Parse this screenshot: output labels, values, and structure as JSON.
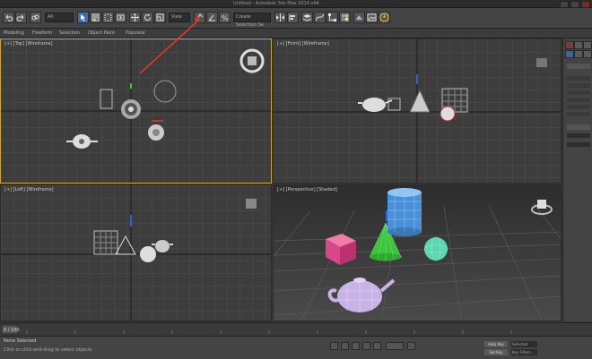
{
  "window": {
    "title": "Untitled - Autodesk 3ds Max 2014 x64",
    "buttons": [
      "minimize",
      "maximize",
      "close"
    ]
  },
  "toolbar": {
    "selection_filter": "All",
    "reference_coord": "View",
    "named_selection_set": "Create Selection Se",
    "tools": [
      "undo-icon",
      "redo-icon",
      "link-icon",
      "unlink-icon",
      "bind-icon",
      "select-icon",
      "select-by-name-icon",
      "rect-region-icon",
      "window-crossing-icon",
      "move-icon",
      "rotate-icon",
      "scale-icon",
      "pivot-icon",
      "select-manipulate-icon",
      "keyboard-shortcut-icon",
      "snaps-icon",
      "angle-snap-icon",
      "percent-snap-icon",
      "spinner-snap-icon",
      "edit-named-sel-icon",
      "mirror-icon",
      "align-icon",
      "layer-icon",
      "graphite-icon",
      "curve-editor-icon",
      "schematic-icon",
      "material-editor-icon",
      "render-setup-icon",
      "render-frame-icon",
      "render-icon"
    ],
    "active_tool": "select-icon"
  },
  "ribbon": {
    "tabs": [
      "Modeling",
      "Freeform",
      "Selection",
      "Object Paint",
      "Populate"
    ]
  },
  "viewports": {
    "top": {
      "label": "[+] [Top] [Wireframe]",
      "active": true
    },
    "front": {
      "label": "[+] [Front] [Wireframe]",
      "active": false
    },
    "left": {
      "label": "[+] [Left] [Wireframe]",
      "active": false
    },
    "perspective": {
      "label": "[+] [Perspective] [Shaded]",
      "active": false
    }
  },
  "scene_objects": [
    {
      "name": "Teapot",
      "color": "#c9b3e6"
    },
    {
      "name": "Cone",
      "color": "#3ac63a"
    },
    {
      "name": "Box",
      "color": "#d9468a"
    },
    {
      "name": "Cylinder",
      "color": "#5aa6e6"
    },
    {
      "name": "Sphere",
      "color": "#5ad6b0"
    },
    {
      "name": "Torus",
      "color": "#e6e6e6"
    }
  ],
  "command_panel": {
    "tabs": [
      "create-icon",
      "modify-icon",
      "hierarchy-icon",
      "motion-icon",
      "display-icon",
      "utilities-icon"
    ],
    "rows": [
      "Object Type",
      "AutoGrid",
      "Box",
      "Cone",
      "Sphere",
      "Cylinder",
      "Tube",
      "Torus",
      "Teapot",
      "Name and Color"
    ]
  },
  "timeline": {
    "frame_counter": "0 / 100",
    "ticks": [
      "0",
      "10",
      "20",
      "30",
      "40",
      "50",
      "60",
      "70",
      "80",
      "90",
      "100"
    ]
  },
  "status": {
    "line1": "None Selected",
    "line2": "Click or click-and-drag to select objects",
    "auto_key": "Auto Key",
    "set_key": "Set Key",
    "key_filters": "Key Filters...",
    "selected_label": "Selected"
  },
  "annotation": {
    "arrow_color": "#e0362c"
  }
}
